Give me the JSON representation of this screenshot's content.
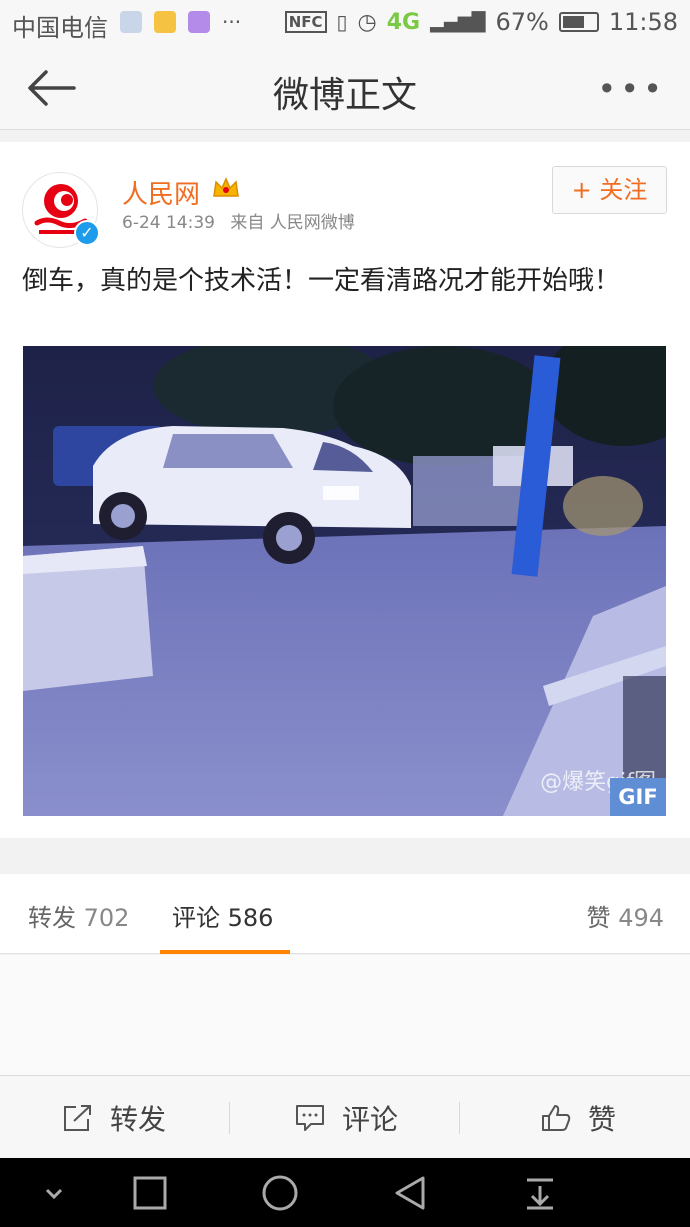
{
  "status_bar": {
    "carrier": "中国电信",
    "network": "4G",
    "battery": "67%",
    "battery_level": 0.67,
    "time": "11:58",
    "nfc": "NFC"
  },
  "title_bar": {
    "title": "微博正文"
  },
  "post": {
    "username": "人民网",
    "timestamp": "6-24 14:39",
    "source": "来自 人民网微博",
    "follow_label": "+ 关注",
    "content": "倒车，真的是个技术活！一定看清路况才能开始哦！",
    "media_badge": "GIF",
    "watermark": "@爆笑gif图"
  },
  "tabs": [
    {
      "label": "转发",
      "count": "702"
    },
    {
      "label": "评论",
      "count": "586"
    },
    {
      "label": "赞",
      "count": "494"
    }
  ],
  "actions": [
    {
      "label": "转发",
      "icon": "repost-icon"
    },
    {
      "label": "评论",
      "icon": "comment-icon"
    },
    {
      "label": "赞",
      "icon": "like-icon"
    }
  ],
  "colors": {
    "accent": "#f06d21",
    "tab_underline": "#ff8200",
    "verified": "#1e9bea",
    "gif_badge": "#5f8ed4"
  }
}
